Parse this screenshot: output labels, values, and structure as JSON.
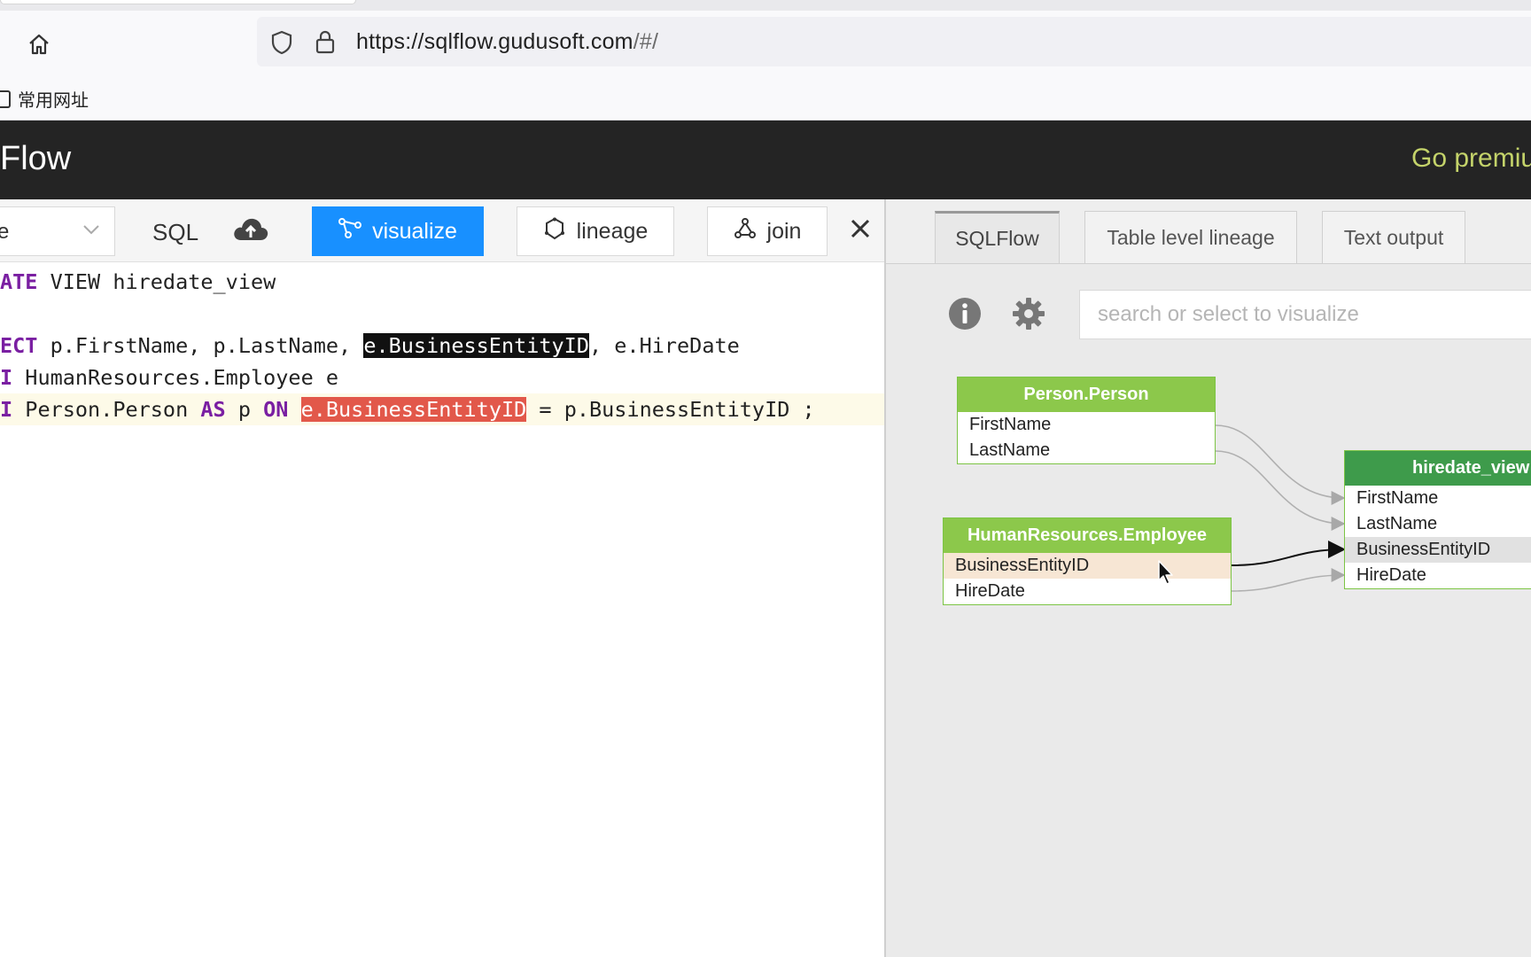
{
  "browser": {
    "url_host": "https://sqlflow.gudusoft.com",
    "url_path": "/#/",
    "bookmark": "常用网址"
  },
  "app": {
    "title": "Flow",
    "premium_link": "Go premiu"
  },
  "editor": {
    "db_select_value": "e",
    "sql_label": "SQL",
    "visualize_label": "visualize",
    "lineage_label": "lineage",
    "join_label": "join",
    "lines": [
      {
        "kw": "ATE",
        "rest": " VIEW hiredate_view"
      },
      {
        "kw": "",
        "rest": ""
      },
      {
        "kw": "ECT",
        "pre": " p.FirstName, p.LastName, ",
        "sel": "e.BusinessEntityID",
        "post": ", e.HireDate"
      },
      {
        "kw": "I",
        "rest": " HumanResources.Employee e"
      },
      {
        "kw": "I",
        "pre": " Person.Person ",
        "as": "AS",
        "mid": " p ",
        "on": "ON",
        "sp": " ",
        "hl": "e.BusinessEntityID",
        "post": " = p.BusinessEntityID ;"
      }
    ]
  },
  "right": {
    "tabs": [
      "SQLFlow",
      "Table level lineage",
      "Text output"
    ],
    "search_placeholder": "search or select to visualize",
    "tables": {
      "person": {
        "name": "Person.Person",
        "columns": [
          "FirstName",
          "LastName"
        ]
      },
      "employee": {
        "name": "HumanResources.Employee",
        "columns": [
          "BusinessEntityID",
          "HireDate"
        ]
      },
      "view": {
        "name": "hiredate_view",
        "columns": [
          "FirstName",
          "LastName",
          "BusinessEntityID",
          "HireDate"
        ]
      }
    }
  },
  "colors": {
    "primary": "#1890ff",
    "header_bg": "#242424",
    "premium": "#c4d36a",
    "table_header": "#8cc84b",
    "view_header": "#3e9b4b",
    "highlight": "#e2584a"
  }
}
